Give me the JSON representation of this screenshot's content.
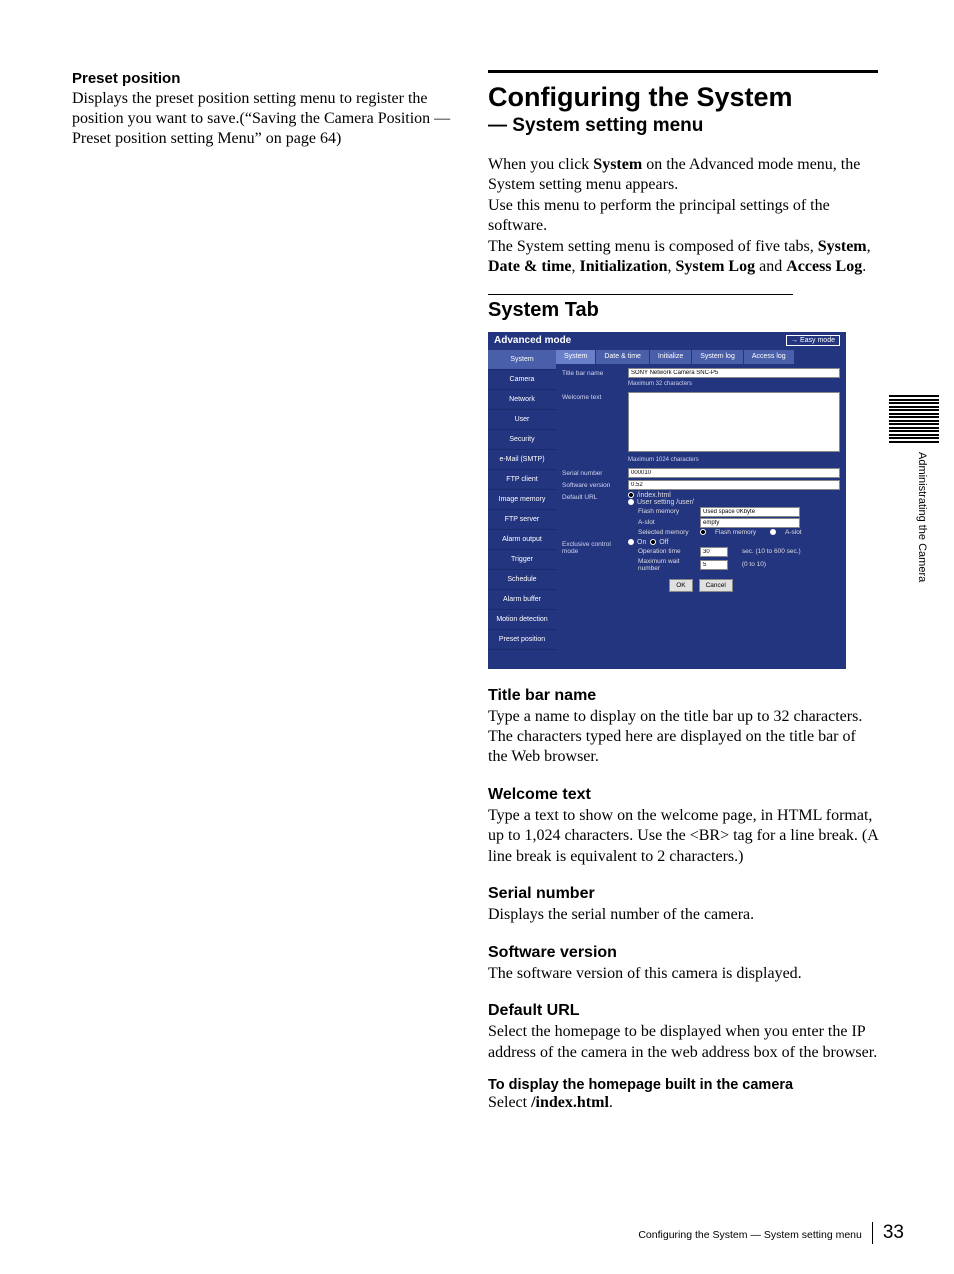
{
  "left": {
    "heading": "Preset position",
    "body": "Displays the preset position setting menu to register the position you want to save.(“Saving the Camera Position — Preset position setting Menu” on page 64)"
  },
  "right": {
    "h1": "Configuring the System",
    "sub": "— System setting menu",
    "intro_1a": "When you click ",
    "intro_1b": "System",
    "intro_1c": " on the Advanced mode menu, the System setting menu appears.",
    "intro_2": "Use this menu to perform the principal settings of the software.",
    "intro_3a": "The System setting menu is composed of five tabs, ",
    "intro_3b": "System",
    "intro_3c": ", ",
    "intro_3d": "Date & time",
    "intro_3e": ", ",
    "intro_3f": "Initialization",
    "intro_3g": ", ",
    "intro_3h": "System Log",
    "intro_3i": " and ",
    "intro_3j": "Access Log",
    "intro_3k": ".",
    "tab_h2": "System Tab",
    "s1_h": "Title bar name",
    "s1_b": "Type a name to display on the title bar up to 32 characters. The characters typed here are displayed on the title bar of the Web browser.",
    "s2_h": "Welcome text",
    "s2_b": "Type a text to show on the welcome page, in HTML format, up to 1,024 characters.  Use the <BR> tag for a line break. (A line break is equivalent to 2 characters.)",
    "s3_h": "Serial number",
    "s3_b": "Displays the serial number of the camera.",
    "s4_h": "Software version",
    "s4_b": "The software version of this camera is displayed.",
    "s5_h": "Default URL",
    "s5_b": "Select the homepage to be displayed when you enter the IP address of the camera in the web address box of the browser.",
    "s6_h": "To display the homepage built in the camera",
    "s6_b_a": "Select ",
    "s6_b_b": "/index.html",
    "s6_b_c": "."
  },
  "shot": {
    "header_title": "Advanced mode",
    "easy_mode": "Easy mode",
    "side": [
      "System",
      "Camera",
      "Network",
      "User",
      "Security",
      "e-Mail (SMTP)",
      "FTP client",
      "Image memory",
      "FTP server",
      "Alarm output",
      "Trigger",
      "Schedule",
      "Alarm buffer",
      "Motion detection",
      "Preset position"
    ],
    "tabs": [
      "System",
      "Date & time",
      "Initialize",
      "System log",
      "Access log"
    ],
    "title_bar_lbl": "Title bar name",
    "title_bar_val": "SONY Network Camera SNC-P5",
    "title_bar_note": "Maximum 32 characters",
    "welcome_lbl": "Welcome text",
    "welcome_note": "Maximum 1024 characters",
    "serial_lbl": "Serial number",
    "serial_val": "000010",
    "soft_lbl": "Software version",
    "soft_val": "0.52",
    "url_lbl": "Default URL",
    "url_opt1": "/index.html",
    "url_opt2": "User setting /user/",
    "flash_lbl": "Flash memory",
    "flash_val": "Used space 0Kbyte",
    "aslot_lbl": "A-slot",
    "aslot_val": "empty",
    "selmem": "Selected memory",
    "selmem_a": "Flash memory",
    "selmem_b": "A-slot",
    "excl_lbl": "Exclusive control mode",
    "on": "On",
    "off": "Off",
    "op_lbl": "Operation time",
    "op_val": "30",
    "op_note": "sec. (10 to 600 sec.)",
    "mw_lbl": "Maximum wait number",
    "mw_val": "5",
    "mw_note": "(0 to 10)",
    "ok": "OK",
    "cancel": "Cancel"
  },
  "sidetab": "Administrating the Camera",
  "footer": {
    "text": "Configuring the System — System setting menu",
    "page": "33"
  }
}
